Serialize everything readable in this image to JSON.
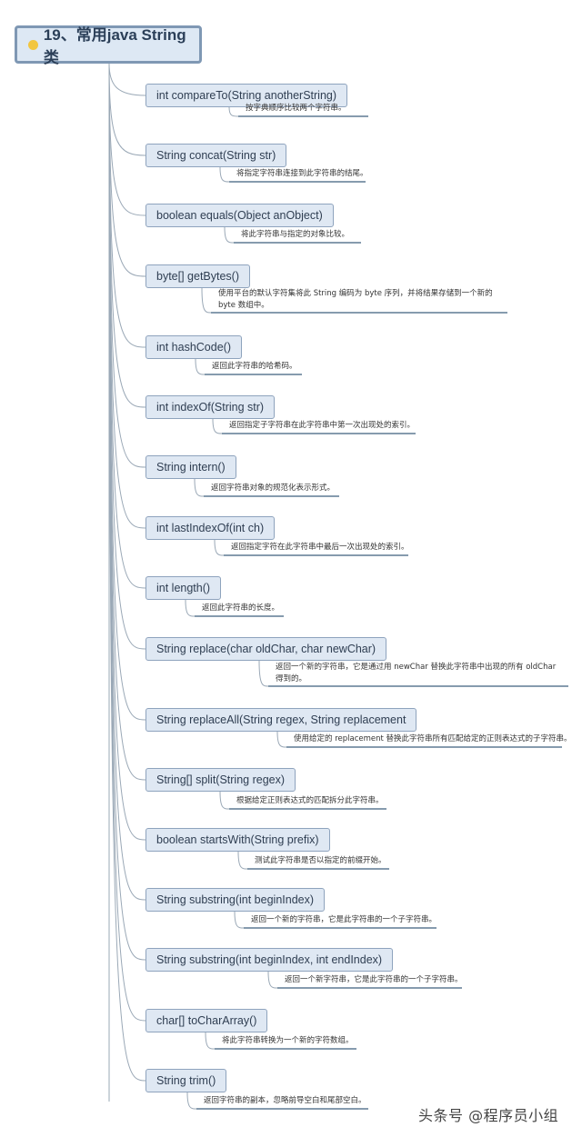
{
  "root": {
    "icon": "smiley-icon",
    "title": "19、常用java String类"
  },
  "methods": [
    {
      "signature": "int compareTo(String anotherString)",
      "description": "按字典顺序比较两个字符串。"
    },
    {
      "signature": "String concat(String str)",
      "description": "将指定字符串连接到此字符串的结尾。"
    },
    {
      "signature": "boolean equals(Object anObject)",
      "description": "将此字符串与指定的对象比较。"
    },
    {
      "signature": "byte[] getBytes()",
      "description": "使用平台的默认字符集将此 String 编码为 byte 序列，并将结果存储到一个新的 byte 数组中。"
    },
    {
      "signature": "int hashCode()",
      "description": "返回此字符串的哈希码。"
    },
    {
      "signature": "int indexOf(String str)",
      "description": "返回指定子字符串在此字符串中第一次出现处的索引。"
    },
    {
      "signature": "String intern()",
      "description": "返回字符串对象的规范化表示形式。"
    },
    {
      "signature": "int lastIndexOf(int ch)",
      "description": "返回指定字符在此字符串中最后一次出现处的索引。"
    },
    {
      "signature": "int length()",
      "description": "返回此字符串的长度。"
    },
    {
      "signature": "String replace(char oldChar, char newChar)",
      "description": "返回一个新的字符串，它是通过用 newChar 替换此字符串中出现的所有 oldChar 得到的。"
    },
    {
      "signature": "String replaceAll(String regex, String replacement",
      "description": "使用给定的 replacement 替换此字符串所有匹配给定的正则表达式的子字符串。"
    },
    {
      "signature": "String[] split(String regex)",
      "description": "根据给定正则表达式的匹配拆分此字符串。"
    },
    {
      "signature": "boolean startsWith(String prefix)",
      "description": "测试此字符串是否以指定的前缀开始。"
    },
    {
      "signature": "String substring(int beginIndex)",
      "description": "返回一个新的字符串，它是此字符串的一个子字符串。"
    },
    {
      "signature": "String substring(int beginIndex, int endIndex)",
      "description": "返回一个新字符串，它是此字符串的一个子字符串。"
    },
    {
      "signature": "char[] toCharArray()",
      "description": "将此字符串转换为一个新的字符数组。"
    },
    {
      "signature": "String trim()",
      "description": "返回字符串的副本，忽略前导空白和尾部空白。"
    }
  ],
  "watermark": "头条号 @程序员小组",
  "colors": {
    "node_fill": "#dfe8f3",
    "node_border": "#8ea3bd",
    "root_border": "#7f98b4",
    "connector": "#9aa8b6",
    "underline": "#5f7a94"
  }
}
